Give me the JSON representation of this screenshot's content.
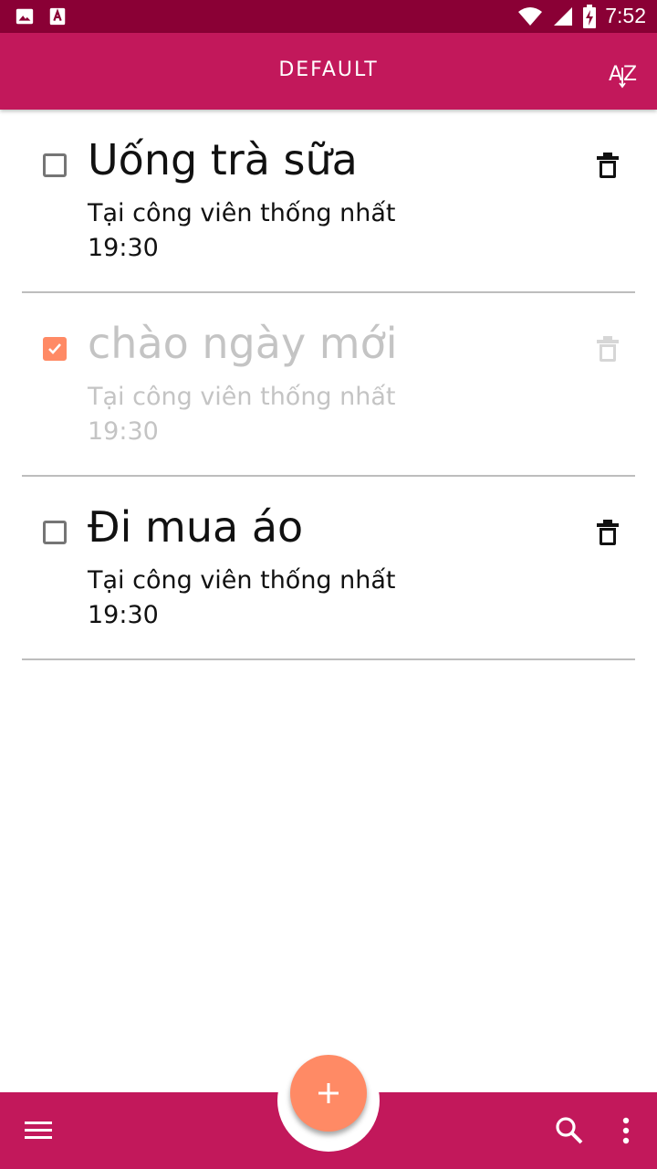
{
  "status_bar": {
    "time": "7:52",
    "icons": [
      "image-icon",
      "text-a-icon",
      "wifi-icon",
      "signal-icon",
      "battery-charging-icon"
    ]
  },
  "app_bar": {
    "title": "DEFAULT",
    "sort_icon": "sort-az-icon"
  },
  "todos": [
    {
      "title": "Uống trà sữa",
      "place": "Tại công viên thống nhất",
      "time": "19:30",
      "done": false
    },
    {
      "title": "chào ngày mới",
      "place": "Tại công viên thống nhất",
      "time": "19:30",
      "done": true
    },
    {
      "title": "Đi mua áo",
      "place": "Tại công viên thống nhất",
      "time": "19:30",
      "done": false
    }
  ],
  "bottom_bar": {
    "menu_icon": "menu-icon",
    "add_icon": "add-icon",
    "search_icon": "search-icon",
    "more_icon": "more-vert-icon"
  },
  "colors": {
    "status_bar": "#8a0035",
    "primary": "#c2185b",
    "accent": "#ff8a65",
    "done_text": "#c4c4c4"
  }
}
